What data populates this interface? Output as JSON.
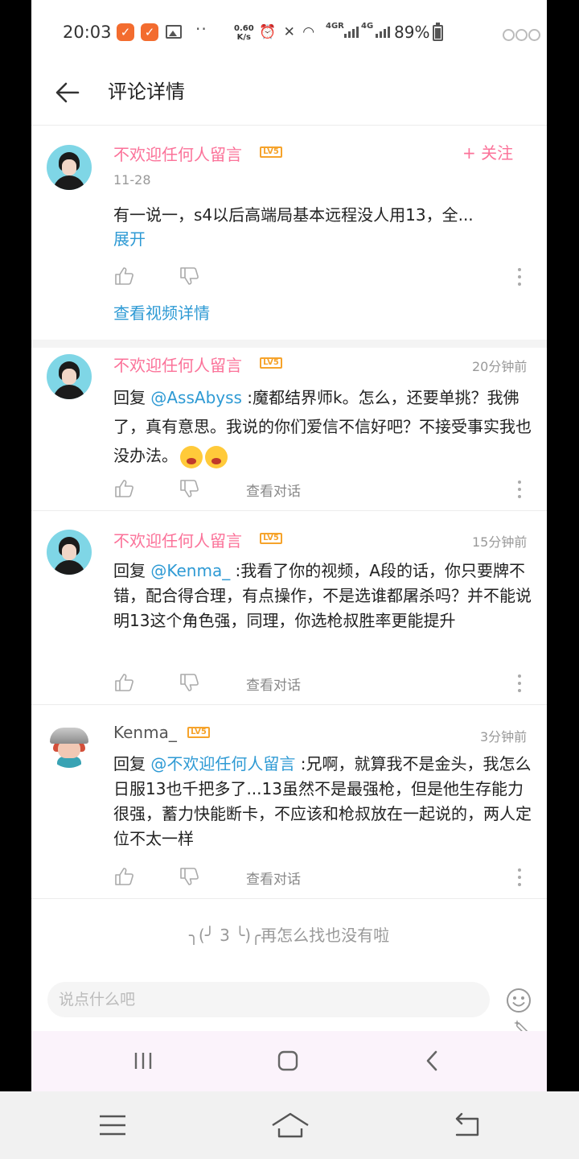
{
  "status_bar": {
    "time": "20:03",
    "speed_value": "0.60",
    "speed_unit": "K/s",
    "sig1": "4GR",
    "sig2": "4G",
    "battery": "89%"
  },
  "header": {
    "title": "评论详情",
    "back_icon": "back-arrow-icon"
  },
  "main_comment": {
    "user": "不欢迎任何人留言",
    "level": "LV5",
    "follow": "+ 关注",
    "date": "11-28",
    "text": "有一说一，s4以后高端局基本远程没人用13，全...",
    "expand": "展开",
    "video_link": "查看视频详情"
  },
  "replies": [
    {
      "user": "不欢迎任何人留言",
      "level": "LV5",
      "time": "20分钟前",
      "prefix": "回复 ",
      "mention": "@AssAbyss",
      "text": " :魔都结界师k。怎么，还要单挑？我佛了，真有意思。我说的你们爱信不信好吧？不接受事实我也没办法。",
      "dialog": "查看对话"
    },
    {
      "user": "不欢迎任何人留言",
      "level": "LV5",
      "time": "15分钟前",
      "prefix": "回复 ",
      "mention": "@Kenma_",
      "text": " :我看了你的视频，A段的话，你只要牌不错，配合得合理，有点操作，不是选谁都屠杀吗？并不能说明13这个角色强，同理，你选枪叔胜率更能提升",
      "dialog": "查看对话"
    },
    {
      "user": "Kenma_",
      "level": "LV5",
      "time": "3分钟前",
      "prefix": "回复 ",
      "mention": "@不欢迎任何人留言",
      "text": " :兄啊，就算我不是金头，我怎么日服13也千把多了...13虽然不是最强枪，但是他生存能力很强，蓄力快能断卡，不应该和枪叔放在一起说的，两人定位不太一样",
      "dialog": "查看对话"
    }
  ],
  "footer_note": "╮(╯ 3 ╰)╭再怎么找也没有啦",
  "input": {
    "placeholder": "说点什么吧"
  },
  "colors": {
    "username_pink": "#fb7299",
    "link_blue": "#2e9ad4",
    "level_orange": "#f6a32b"
  }
}
